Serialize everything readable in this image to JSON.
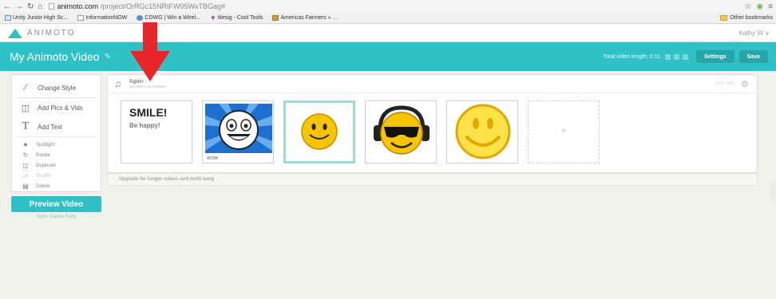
{
  "browser": {
    "url_host": "animoto.com",
    "url_path": "/project/OrRGc15NRtFW05WxTBGag#"
  },
  "bookmarks": [
    {
      "label": "Unity Junior High Sc..."
    },
    {
      "label": "InformationNOW"
    },
    {
      "label": "CDWG | Win a Wirel..."
    },
    {
      "label": "tilesig - Cool Tools"
    },
    {
      "label": "Americas Farmers » ..."
    }
  ],
  "bookmarks_other": "Other bookmarks",
  "app": {
    "logo": "ANIMOTO",
    "user": "Kathy W ∨",
    "project_title": "My Animoto Video",
    "video_length": "Total video length: 0:11",
    "settings_label": "Settings",
    "save_label": "Save"
  },
  "sidebar": {
    "items": [
      {
        "label": "Change Style",
        "icon": "brush-icon"
      },
      {
        "label": "Add Pics & Vids",
        "icon": "pictures-icon"
      },
      {
        "label": "Add Text",
        "icon": "text-icon"
      }
    ],
    "small_items": [
      {
        "label": "Spotlight",
        "icon": "star-icon"
      },
      {
        "label": "Rotate",
        "icon": "rotate-icon"
      },
      {
        "label": "Duplicate",
        "icon": "duplicate-icon"
      },
      {
        "label": "Shuffle",
        "icon": "shuffle-icon"
      },
      {
        "label": "Delete",
        "icon": "trash-icon"
      }
    ]
  },
  "preview": {
    "button_label": "Preview Video",
    "style_label": "Style: Dance Party"
  },
  "song": {
    "title": "Again",
    "artist": "SECRETS IN STEREO",
    "time": "0:11 / 3:27"
  },
  "tiles": [
    {
      "type": "text",
      "title": "SMILE!",
      "subtitle": "Be happy!"
    },
    {
      "type": "image",
      "caption": "WOW!"
    },
    {
      "type": "image"
    },
    {
      "type": "image"
    },
    {
      "type": "image"
    },
    {
      "type": "add",
      "label": "+"
    }
  ],
  "upgrade_text": "Upgrade for longer videos and multi song",
  "colors": {
    "accent": "#2fc1c6",
    "annotation_arrow": "#e8262a"
  }
}
